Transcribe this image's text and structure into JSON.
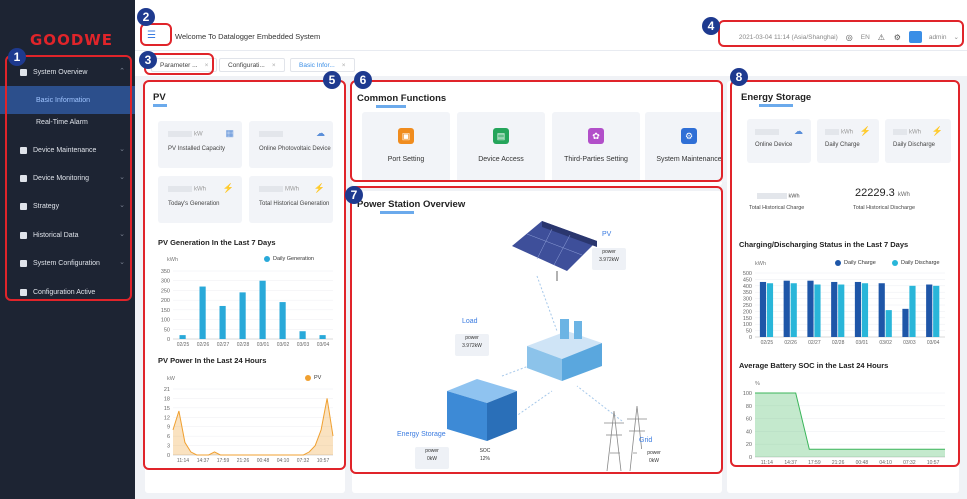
{
  "brand": {
    "logo": "GOODWE",
    "accent": "#e0242a",
    "primary": "#3a8ee6"
  },
  "sidebar": {
    "items": [
      {
        "label": "System Overview",
        "icon": "pie-icon"
      },
      {
        "label": "Basic Information"
      },
      {
        "label": "Real-Time Alarm"
      },
      {
        "label": "Device Maintenance",
        "icon": "shield-icon"
      },
      {
        "label": "Device Monitoring",
        "icon": "monitor-icon"
      },
      {
        "label": "Strategy",
        "icon": "doc-icon"
      },
      {
        "label": "Historical Data",
        "icon": "chart-icon"
      },
      {
        "label": "System Configuration",
        "icon": "gear-icon"
      },
      {
        "label": "Configuration Active",
        "icon": "check-icon"
      }
    ]
  },
  "topbar": {
    "menu_icon": "☰",
    "title": "Welcome To Datalogger Embedded System",
    "datetime": "2021-03-04 11:14 (Asia/Shanghai)",
    "lang": "EN",
    "user": "admin"
  },
  "tabs": [
    {
      "label": "Parameter ..."
    },
    {
      "label": "Configurati..."
    },
    {
      "label": "Basic Infor..."
    }
  ],
  "pv": {
    "title": "PV",
    "kpis": [
      {
        "unit": "kW",
        "label": "PV Installed Capacity"
      },
      {
        "unit": "",
        "label": "Online Photovoltaic Device"
      },
      {
        "unit": "kWh",
        "label": "Today's Generation"
      },
      {
        "unit": "MWh",
        "label": "Total Historical Generation"
      }
    ],
    "gen_title": "PV Generation In the Last 7 Days",
    "gen_unit": "kWh",
    "gen_legend": "Daily Generation",
    "power_title": "PV Power In the Last 24 Hours",
    "power_unit": "kW",
    "power_legend": "PV"
  },
  "common": {
    "title": "Common Functions",
    "items": [
      {
        "label": "Port Setting",
        "icon": "port-icon",
        "color": "#f08c1e"
      },
      {
        "label": "Device Access",
        "icon": "device-access-icon",
        "color": "#25a55b"
      },
      {
        "label": "Third-Parties Setting",
        "icon": "third-party-icon",
        "color": "#b24fc9"
      },
      {
        "label": "System Maintenance",
        "icon": "maintenance-icon",
        "color": "#2f6fd6"
      }
    ]
  },
  "station": {
    "title": "Power Station Overview",
    "pv_label": "PV",
    "pv_power_label": "power",
    "pv_power": "3.972kW",
    "load_label": "Load",
    "load_power_label": "power",
    "load_power": "3.972kW",
    "es_label": "Energy Storage",
    "es_power_label": "power",
    "es_power": "0kW",
    "es_soc_label": "SOC",
    "es_soc": "12%",
    "grid_label": "Grid",
    "grid_power_label": "power",
    "grid_power": "0kW"
  },
  "energy_storage": {
    "title": "Energy Storage",
    "kpis": [
      {
        "unit": "",
        "label": "Online Device"
      },
      {
        "unit": "kWh",
        "label": "Daily Charge"
      },
      {
        "unit": "kWh",
        "label": "Daily Discharge"
      }
    ],
    "hist_charge_unit": "kWh",
    "hist_charge_label": "Total Historical Charge",
    "hist_discharge_value": "22229.3",
    "hist_discharge_unit": "kWh",
    "hist_discharge_label": "Total Historical Discharge",
    "cd_title": "Charging/Discharging Status in the Last 7 Days",
    "cd_unit": "kWh",
    "legend_charge": "Daily Charge",
    "legend_discharge": "Daily Discharge",
    "soc_title": "Average Battery SOC in the Last 24 Hours",
    "soc_unit": "%"
  },
  "callouts": [
    "1",
    "2",
    "3",
    "4",
    "5",
    "6",
    "7",
    "8"
  ],
  "chart_data": [
    {
      "type": "bar",
      "title": "PV Generation In the Last 7 Days",
      "categories": [
        "02/25",
        "02/26",
        "02/27",
        "02/28",
        "03/01",
        "03/02",
        "03/03",
        "03/04"
      ],
      "series": [
        {
          "name": "Daily Generation",
          "values": [
            20,
            270,
            170,
            240,
            300,
            190,
            40,
            20
          ]
        }
      ],
      "ylim": [
        0,
        350
      ],
      "yticks": [
        0,
        50,
        100,
        150,
        200,
        250,
        300,
        350
      ],
      "color": "#29a9d9"
    },
    {
      "type": "area",
      "title": "PV Power In the Last 24 Hours",
      "x": [
        "11:14",
        "14:37",
        "17:59",
        "21:26",
        "00:48",
        "04:10",
        "07:32",
        "10:57"
      ],
      "series": [
        {
          "name": "PV",
          "values": [
            8,
            14,
            4,
            1,
            0,
            0,
            0,
            1,
            0,
            0,
            0,
            0,
            0,
            0,
            0,
            0,
            0,
            0,
            0,
            0,
            0,
            0,
            0,
            1,
            3,
            8,
            18,
            6
          ]
        }
      ],
      "ylim": [
        0,
        21
      ],
      "yticks": [
        0,
        3,
        6,
        9,
        12,
        15,
        18,
        21
      ],
      "color": "#f0a030"
    },
    {
      "type": "bar",
      "title": "Charging/Discharging Status in the Last 7 Days",
      "categories": [
        "02/25",
        "02/26",
        "02/27",
        "02/28",
        "03/01",
        "03/02",
        "03/03",
        "03/04"
      ],
      "series": [
        {
          "name": "Daily Charge",
          "values": [
            430,
            440,
            440,
            430,
            430,
            420,
            220,
            410
          ]
        },
        {
          "name": "Daily Discharge",
          "values": [
            420,
            420,
            410,
            410,
            420,
            210,
            400,
            400
          ]
        }
      ],
      "ylim": [
        0,
        500
      ],
      "yticks": [
        0,
        50,
        100,
        150,
        200,
        250,
        300,
        350,
        400,
        450,
        500
      ],
      "colors": [
        "#1e56a8",
        "#29b6d9"
      ]
    },
    {
      "type": "area",
      "title": "Average Battery SOC in the Last 24 Hours",
      "x": [
        "11:14",
        "14:37",
        "17:59",
        "21:26",
        "00:48",
        "04:10",
        "07:32",
        "10:57"
      ],
      "series": [
        {
          "name": "SOC",
          "values": [
            100,
            100,
            100,
            100,
            12,
            12,
            12,
            12,
            12,
            12,
            12,
            12,
            12,
            12,
            12
          ]
        }
      ],
      "ylim": [
        0,
        100
      ],
      "yticks": [
        0,
        20,
        40,
        60,
        80,
        100
      ],
      "color": "#3bb55a"
    }
  ]
}
